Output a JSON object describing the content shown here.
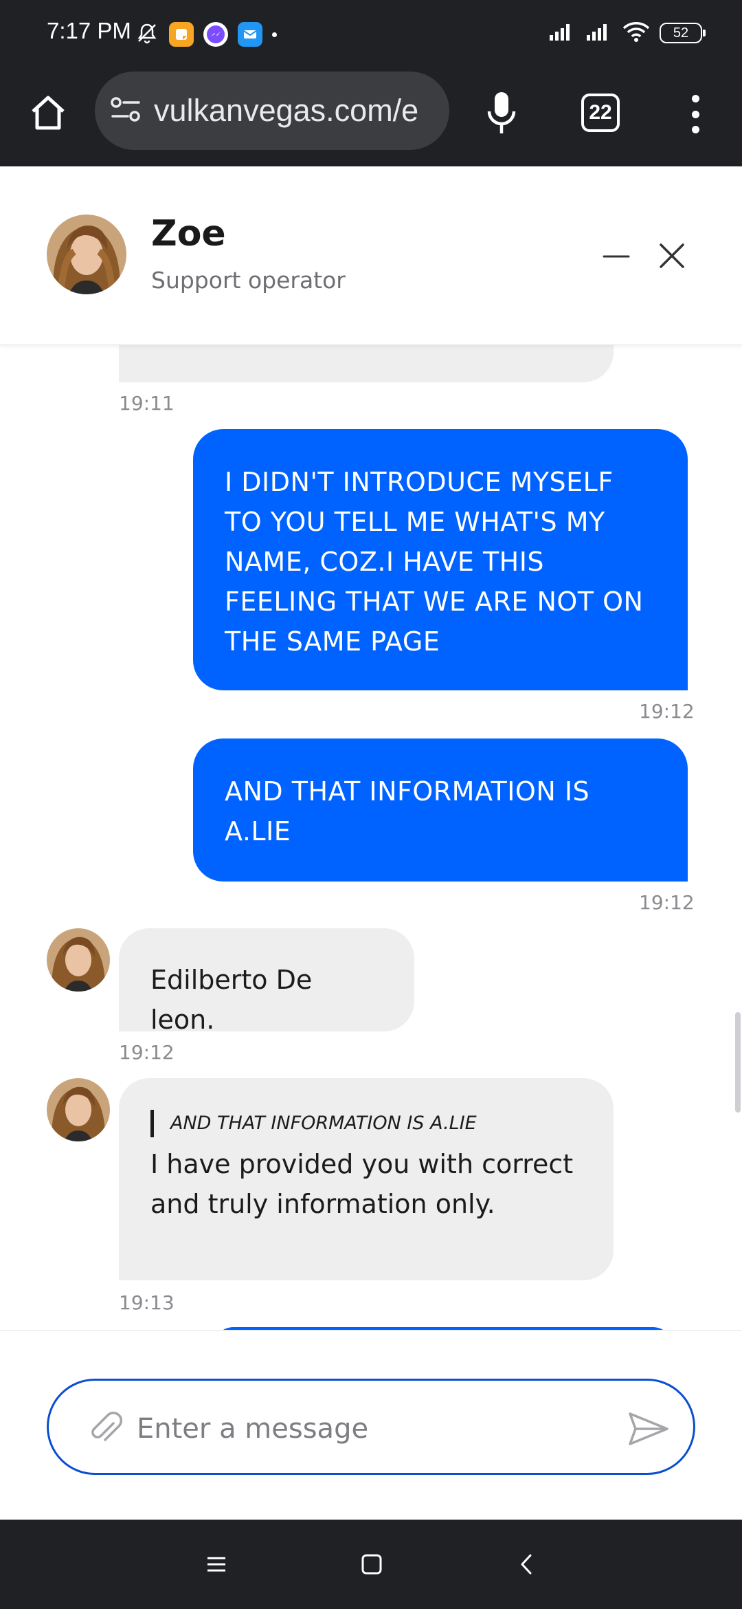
{
  "status_bar": {
    "time": "7:17 PM",
    "battery": "52",
    "icons": [
      "alarm-off-icon",
      "notes-app-icon",
      "messenger-icon",
      "mail-app-icon",
      "signal-icon",
      "signal-icon",
      "wifi-icon",
      "battery-icon"
    ]
  },
  "browser": {
    "url": "vulkanvegas.com/e",
    "tab_count": "22",
    "icons": [
      "home-icon",
      "site-settings-icon",
      "mic-icon",
      "more-vert-icon"
    ]
  },
  "chat_header": {
    "operator_name": "Zoe",
    "operator_role": "Support operator",
    "icons": [
      "minimize-icon",
      "close-icon"
    ]
  },
  "messages": [
    {
      "direction": "in",
      "text": "",
      "time": "19:11"
    },
    {
      "direction": "out",
      "text": "I DIDN'T INTRODUCE MYSELF TO YOU TELL ME WHAT'S MY NAME, COZ.I HAVE THIS FEELING THAT WE ARE NOT ON THE SAME PAGE",
      "time": "19:12"
    },
    {
      "direction": "out",
      "text": "AND THAT INFORMATION IS A.LIE",
      "time": "19:12"
    },
    {
      "direction": "in",
      "text": "Edilberto De leon.",
      "time": "19:12"
    },
    {
      "direction": "in",
      "quote": "AND THAT INFORMATION IS A.LIE",
      "text": "I have provided you with correct and truly information only.",
      "time": "19:13"
    }
  ],
  "composer": {
    "placeholder": "Enter a message",
    "icons": [
      "attach-icon",
      "send-icon"
    ]
  },
  "nav_bar": {
    "icons": [
      "recents-icon",
      "home-square-icon",
      "back-icon"
    ]
  },
  "colors": {
    "outgoing_bubble": "#0063ff",
    "incoming_bubble": "#eeeeee",
    "system_bars": "#202124",
    "input_border": "#0a4fd0"
  }
}
